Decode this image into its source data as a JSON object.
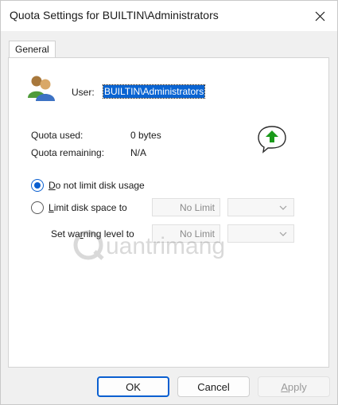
{
  "window": {
    "title": "Quota Settings for BUILTIN\\Administrators"
  },
  "tabs": [
    {
      "label": "General"
    }
  ],
  "user": {
    "label": "User:",
    "value": "BUILTIN\\Administrators"
  },
  "quota": {
    "used_label": "Quota used:",
    "used_value": "0 bytes",
    "remaining_label": "Quota remaining:",
    "remaining_value": "N/A"
  },
  "options": {
    "no_limit_prefix": "D",
    "no_limit_rest": "o not limit disk usage",
    "limit_prefix": "L",
    "limit_rest": "imit disk space to",
    "limit_value": "No Limit",
    "warning_label_a": "Set wa",
    "warning_label_b": "r",
    "warning_label_c": "ning level to",
    "warning_value": "No Limit",
    "selected": "no_limit"
  },
  "buttons": {
    "ok": "OK",
    "cancel": "Cancel",
    "apply_prefix": "A",
    "apply_rest": "pply"
  },
  "watermark": {
    "text": "uantrimang"
  },
  "colors": {
    "accent": "#0a5fd0",
    "selection": "#0a64d2",
    "arrow_green": "#1a9a1a"
  }
}
